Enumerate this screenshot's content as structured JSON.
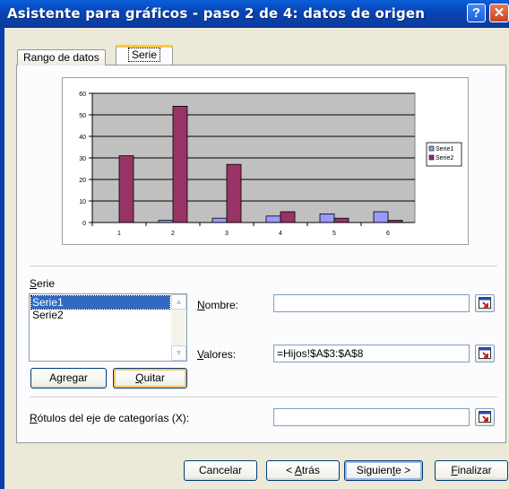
{
  "window": {
    "title": "Asistente para gráficos - paso 2 de 4: datos de origen",
    "help_label": "?",
    "close_label": "✕"
  },
  "tabs": [
    {
      "label": "Rango de datos"
    },
    {
      "label": "Serie"
    }
  ],
  "chart_data": {
    "type": "bar",
    "categories": [
      "1",
      "2",
      "3",
      "4",
      "5",
      "6"
    ],
    "series": [
      {
        "name": "Serie1",
        "values": [
          0,
          1,
          2,
          3,
          4,
          5
        ],
        "color": "#9999ff"
      },
      {
        "name": "Serie2",
        "values": [
          31,
          54,
          27,
          5,
          2,
          1
        ],
        "color": "#993366"
      }
    ],
    "ylim": [
      0,
      60
    ],
    "yticks": [
      "0",
      "10",
      "20",
      "30",
      "40",
      "50",
      "60"
    ],
    "plot_background": "#c0c0c0",
    "grid": true,
    "legend": "right"
  },
  "serie_section": {
    "label_prefix": "",
    "label_accel": "S",
    "label_rest": "erie",
    "items": [
      "Serie1",
      "Serie2"
    ],
    "add_accel_pre": "A",
    "add_accel": "g",
    "add_rest": "regar",
    "remove_accel": "Q",
    "remove_rest": "uitar"
  },
  "fields": {
    "nombre_accel": "N",
    "nombre_rest": "ombre:",
    "nombre_value": "",
    "valores_accel": "V",
    "valores_rest": "alores:",
    "valores_value": "=Hijos!$A$3:$A$8",
    "rotulos_accel": "R",
    "rotulos_rest": "ótulos del eje de categorías (X):",
    "rotulos_value": ""
  },
  "footer": {
    "cancel": "Cancelar",
    "back_pre": "< ",
    "back_accel": "A",
    "back_rest": "trás",
    "next_pre": "Siguien",
    "next_accel": "t",
    "next_rest": "e >",
    "finish_accel": "F",
    "finish_rest": "inalizar"
  }
}
